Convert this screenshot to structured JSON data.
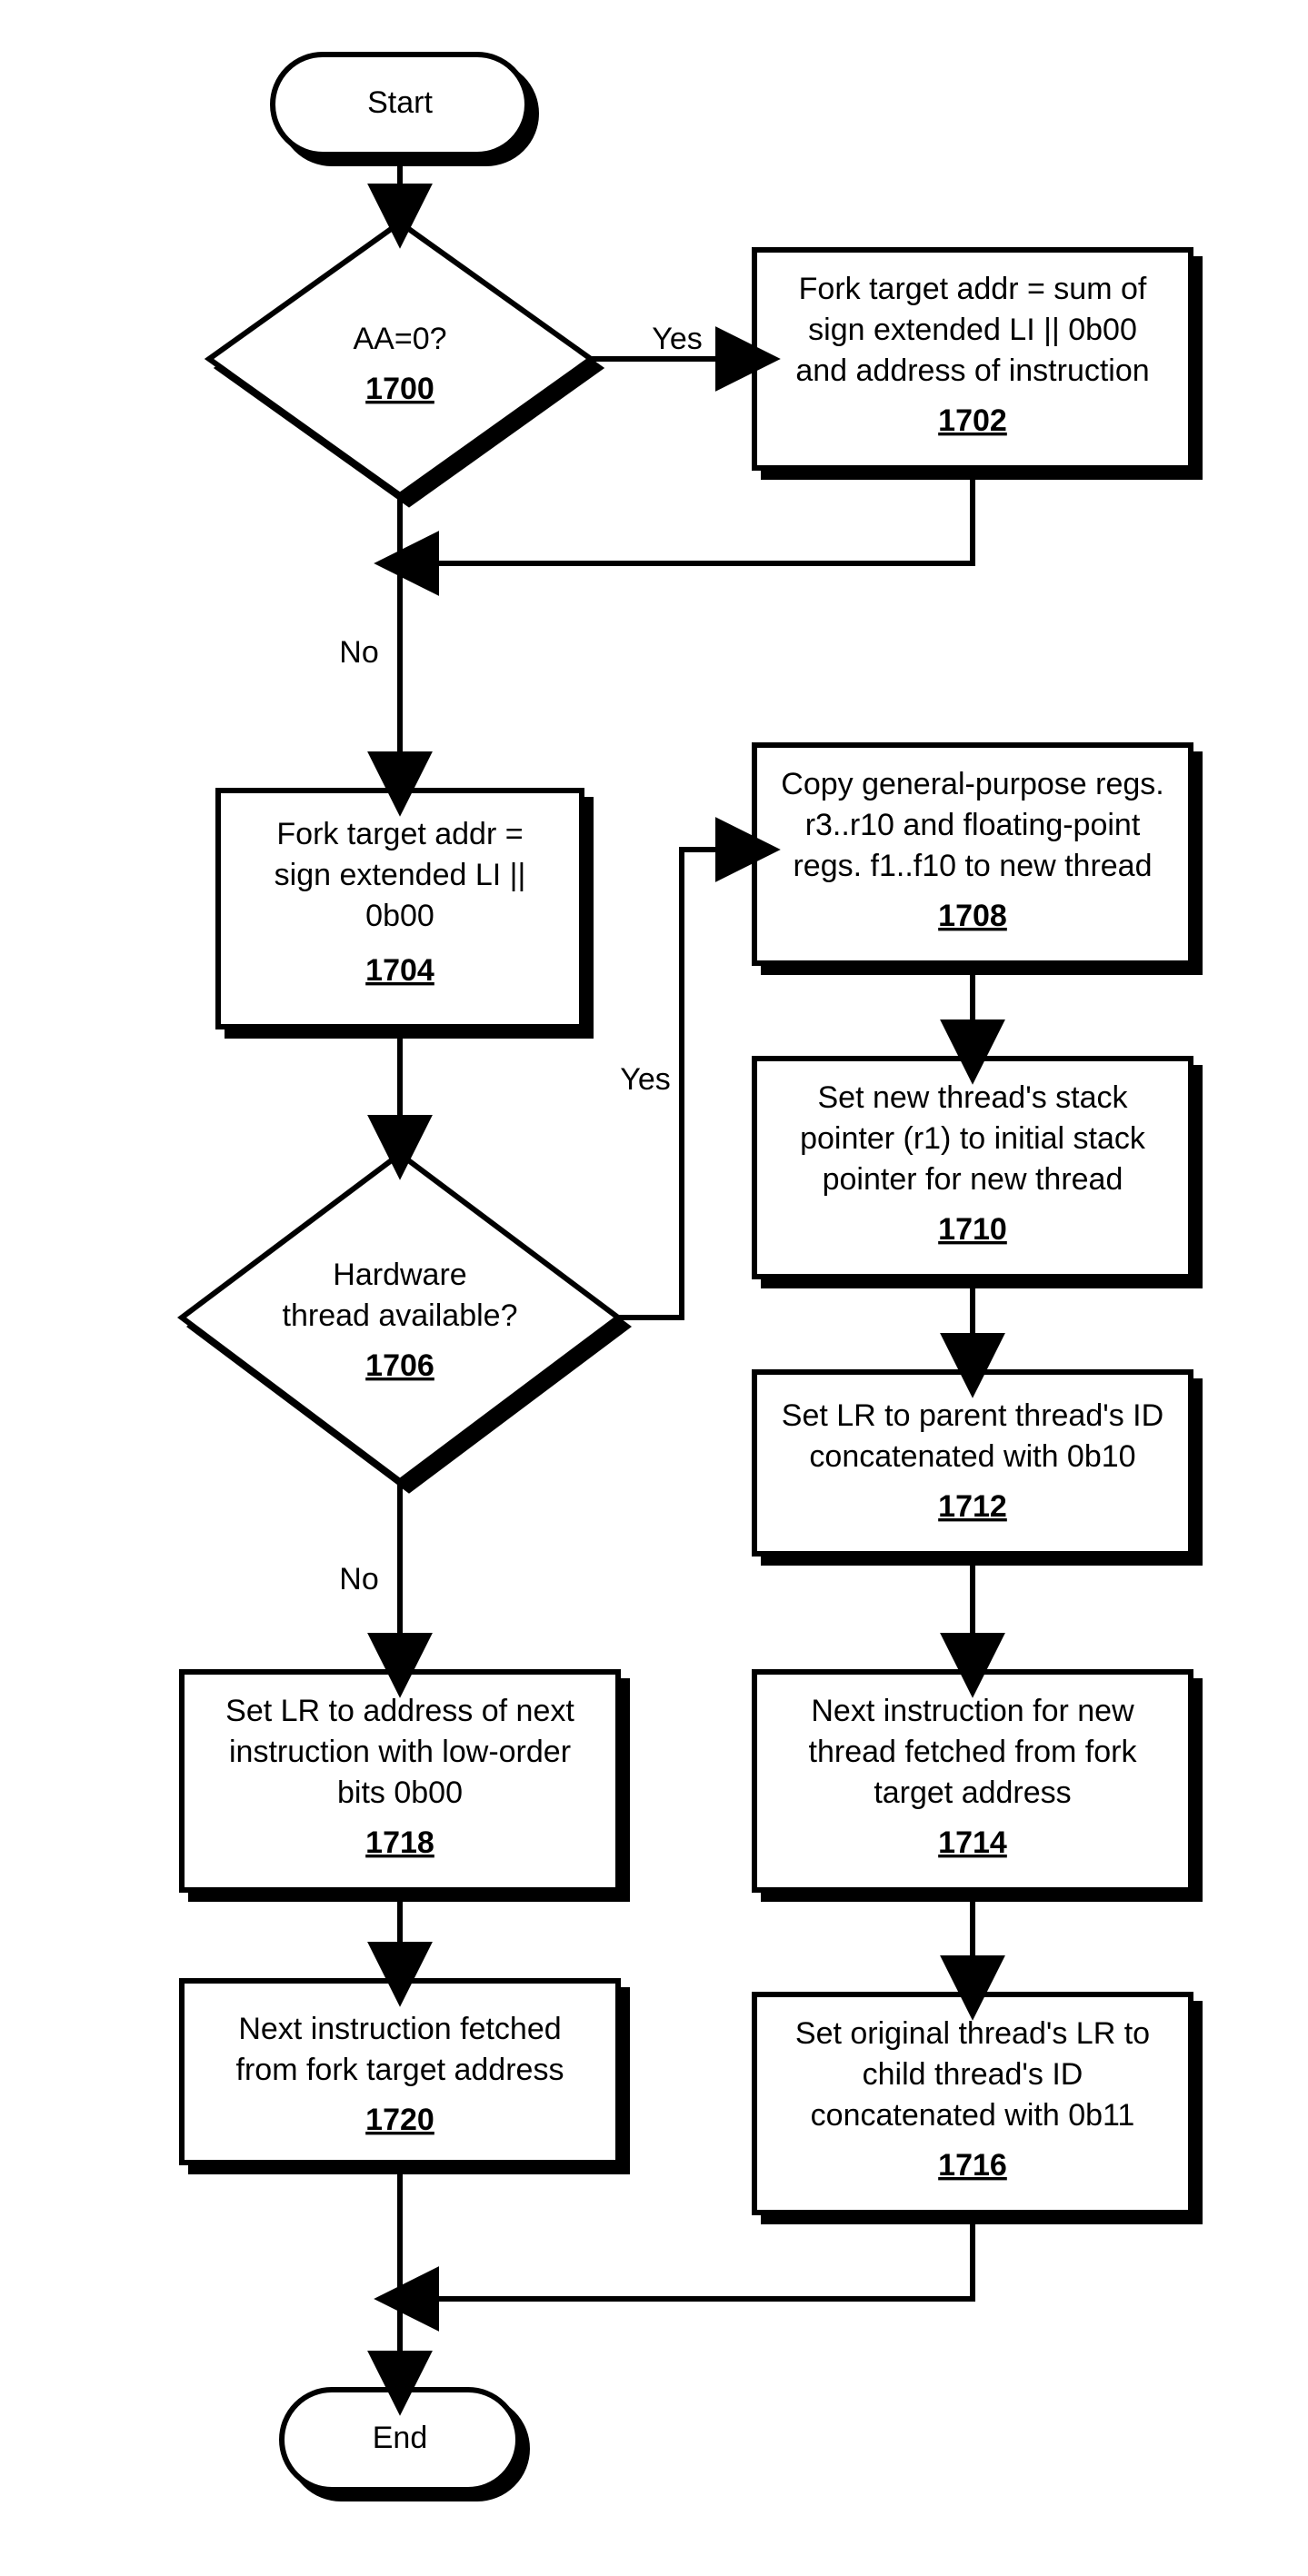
{
  "diagram": {
    "start": {
      "label": "Start"
    },
    "end": {
      "label": "End"
    },
    "d1700": {
      "ref": "1700",
      "lines": [
        "AA=0?"
      ]
    },
    "d1706": {
      "ref": "1706",
      "lines": [
        "Hardware",
        "thread available?"
      ]
    },
    "b1702": {
      "ref": "1702",
      "lines": [
        "Fork target addr = sum of",
        "sign extended LI || 0b00",
        "and address of instruction"
      ]
    },
    "b1704": {
      "ref": "1704",
      "lines": [
        "Fork target addr =",
        "sign extended LI ||",
        "0b00"
      ]
    },
    "b1708": {
      "ref": "1708",
      "lines": [
        "Copy general-purpose regs.",
        "r3..r10 and floating-point",
        "regs. f1..f10 to new thread"
      ]
    },
    "b1710": {
      "ref": "1710",
      "lines": [
        "Set new thread's stack",
        "pointer (r1) to initial stack",
        "pointer for new thread"
      ]
    },
    "b1712": {
      "ref": "1712",
      "lines": [
        "Set LR to parent thread's ID",
        "concatenated with 0b10"
      ]
    },
    "b1714": {
      "ref": "1714",
      "lines": [
        "Next instruction for new",
        "thread fetched from fork",
        "target address"
      ]
    },
    "b1716": {
      "ref": "1716",
      "lines": [
        "Set original thread's LR to",
        "child thread's ID",
        "concatenated with 0b11"
      ]
    },
    "b1718": {
      "ref": "1718",
      "lines": [
        "Set LR to address of next",
        "instruction with low-order",
        "bits 0b00"
      ]
    },
    "b1720": {
      "ref": "1720",
      "lines": [
        "Next instruction fetched",
        "from fork target address"
      ]
    },
    "edges": {
      "d1700_yes": "Yes",
      "d1700_no": "No",
      "d1706_yes": "Yes",
      "d1706_no": "No"
    }
  }
}
